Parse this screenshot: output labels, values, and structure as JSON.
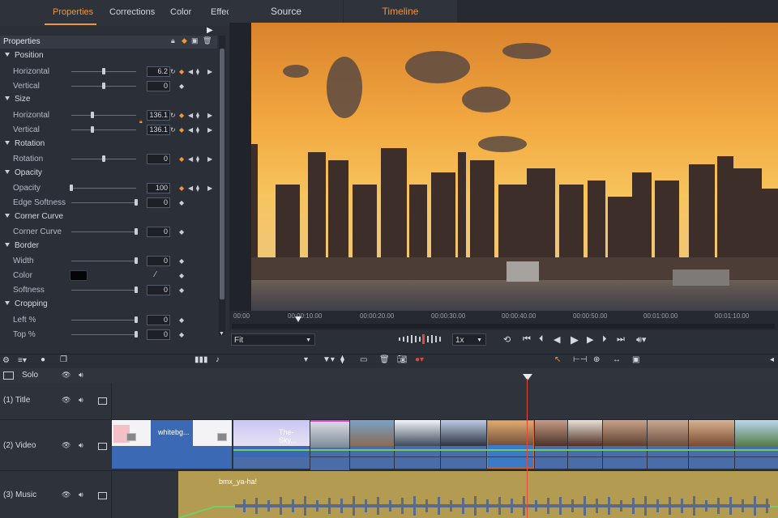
{
  "panel_tabs": [
    "Properties",
    "Corrections",
    "Color",
    "Effects"
  ],
  "view_tabs": [
    "Source",
    "Timeline"
  ],
  "properties": {
    "header": "Properties",
    "sections": [
      {
        "title": "Position",
        "rows": [
          {
            "label": "Horizontal",
            "value": "6.2"
          },
          {
            "label": "Vertical",
            "value": "0"
          }
        ]
      },
      {
        "title": "Size",
        "rows": [
          {
            "label": "Horizontal",
            "value": "136.1"
          },
          {
            "label": "Vertical",
            "value": "136.1"
          }
        ]
      },
      {
        "title": "Rotation",
        "rows": [
          {
            "label": "Rotation",
            "value": "0"
          }
        ]
      },
      {
        "title": "Opacity",
        "rows": [
          {
            "label": "Opacity",
            "value": "100"
          },
          {
            "label": "Edge Softness",
            "value": "0"
          }
        ]
      },
      {
        "title": "Corner Curve",
        "rows": [
          {
            "label": "Corner Curve",
            "value": "0"
          }
        ]
      },
      {
        "title": "Border",
        "rows": [
          {
            "label": "Width",
            "value": "0"
          },
          {
            "label": "Color",
            "value": ""
          },
          {
            "label": "Softness",
            "value": "0"
          }
        ]
      },
      {
        "title": "Cropping",
        "rows": [
          {
            "label": "Left %",
            "value": "0"
          },
          {
            "label": "Top %",
            "value": "0"
          }
        ]
      }
    ]
  },
  "ruler": [
    "00:00",
    "00:00:10.00",
    "00:00:20.00",
    "00:00:30.00",
    "00:00:40.00",
    "00:00:50.00",
    "00:01:00.00",
    "00:01:10.00"
  ],
  "controls": {
    "fit": "Fit",
    "speed": "1x"
  },
  "timeline": {
    "solo": "Solo",
    "tracks": [
      "(1) Title",
      "(2) Video",
      "(3) Music"
    ],
    "clips": {
      "whitebg": "whitebg...",
      "sky": "The-Sky...",
      "music": "bmx_ya-ha!"
    }
  },
  "colors": {
    "accent": "#f0963c",
    "playhead": "#e04a3a",
    "video_clip": "#4a6da8",
    "music_clip": "#b49b52"
  }
}
